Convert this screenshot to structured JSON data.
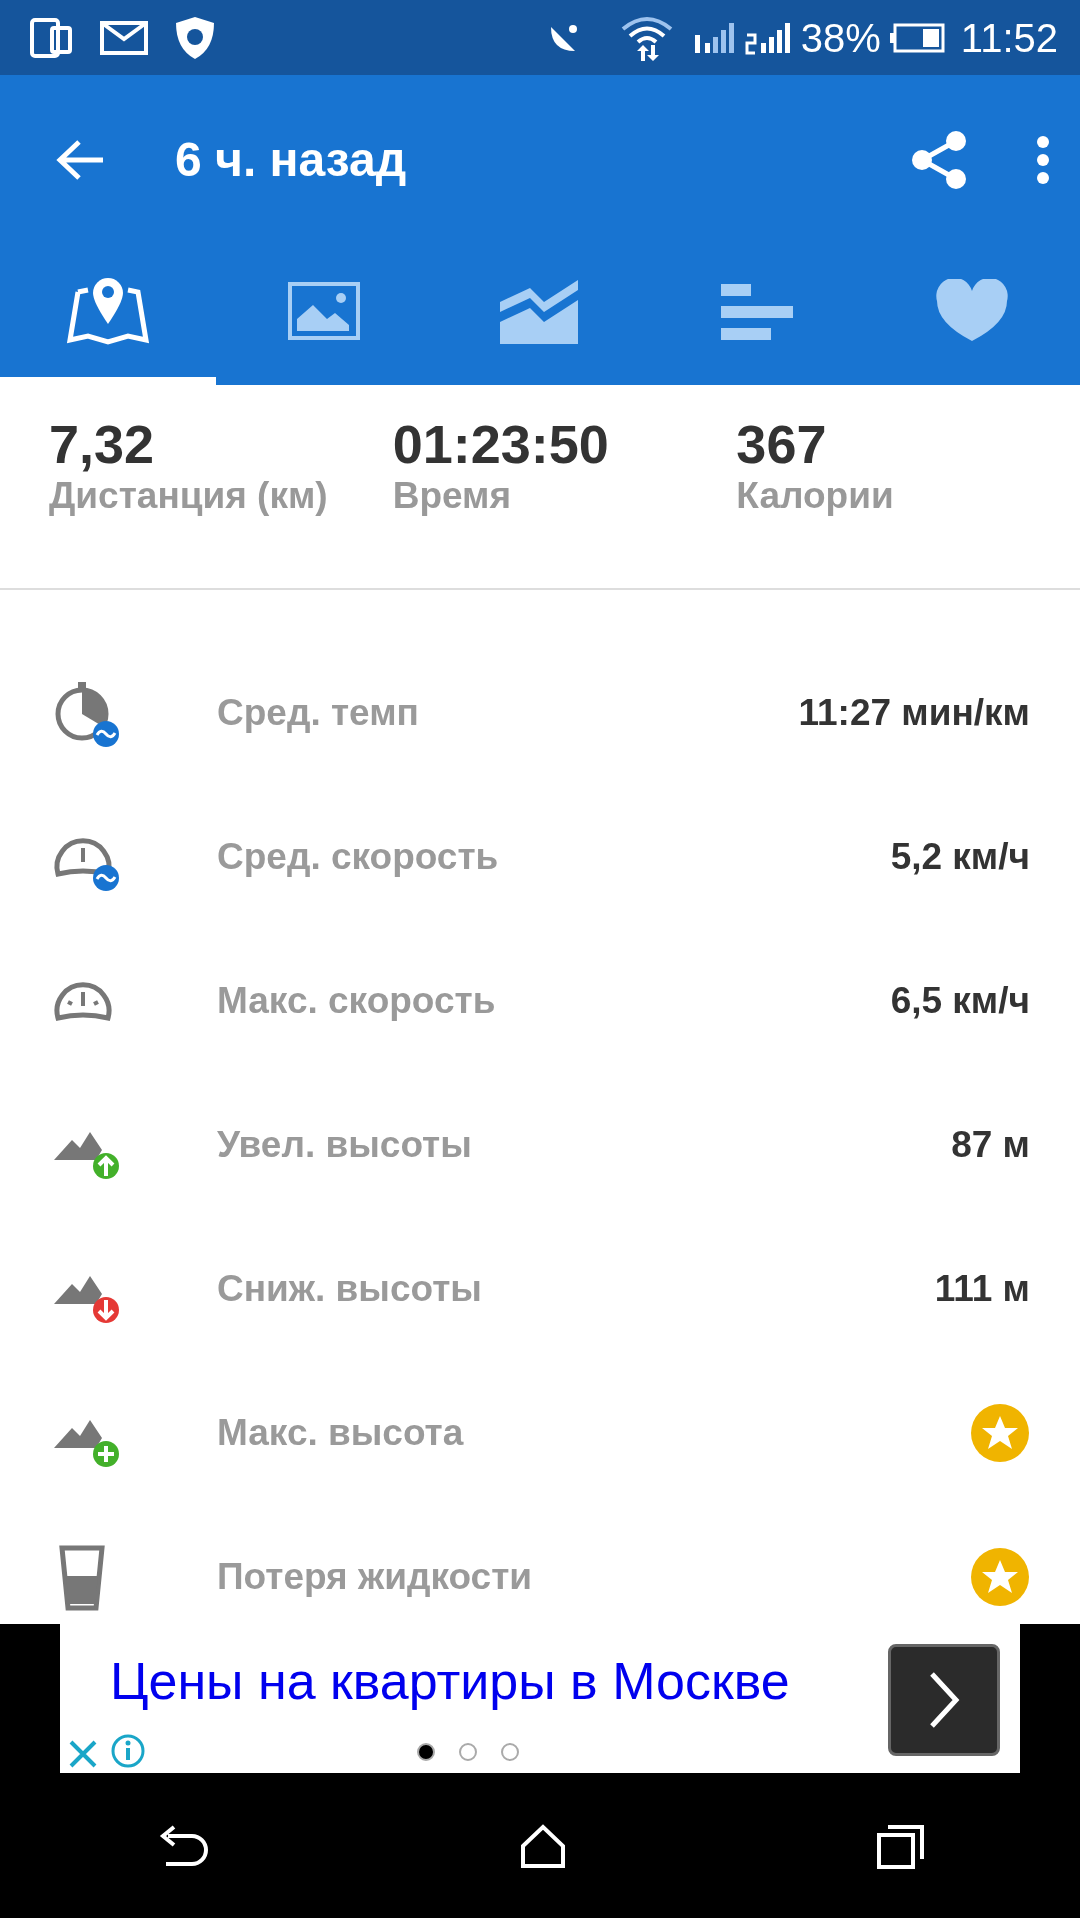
{
  "status_bar": {
    "battery": "38%",
    "time": "11:52"
  },
  "app_bar": {
    "title": "6 ч. назад"
  },
  "tabs": [
    {
      "selected": true
    },
    {
      "selected": false
    },
    {
      "selected": false
    },
    {
      "selected": false
    },
    {
      "selected": false
    }
  ],
  "summary": [
    {
      "value": "7,32",
      "label": "Дистанция (км)"
    },
    {
      "value": "01:23:50",
      "label": "Время"
    },
    {
      "value": "367",
      "label": "Калории"
    }
  ],
  "metrics": [
    {
      "kind": "value",
      "label": "Сред. темп",
      "value": "11:27 мин/км"
    },
    {
      "kind": "value",
      "label": "Сред. скорость",
      "value": "5,2 км/ч"
    },
    {
      "kind": "value",
      "label": "Макс. скорость",
      "value": "6,5 км/ч"
    },
    {
      "kind": "value",
      "label": "Увел. высоты",
      "value": "87 м"
    },
    {
      "kind": "value",
      "label": "Сниж. высоты",
      "value": "111 м"
    },
    {
      "kind": "premium",
      "label": "Макс. высота"
    },
    {
      "kind": "premium",
      "label": "Потеря жидкости"
    }
  ],
  "ad": {
    "text": "Цены на квартиры в Москве",
    "pages": [
      {
        "selected": true
      },
      {
        "selected": false
      },
      {
        "selected": false
      }
    ]
  }
}
